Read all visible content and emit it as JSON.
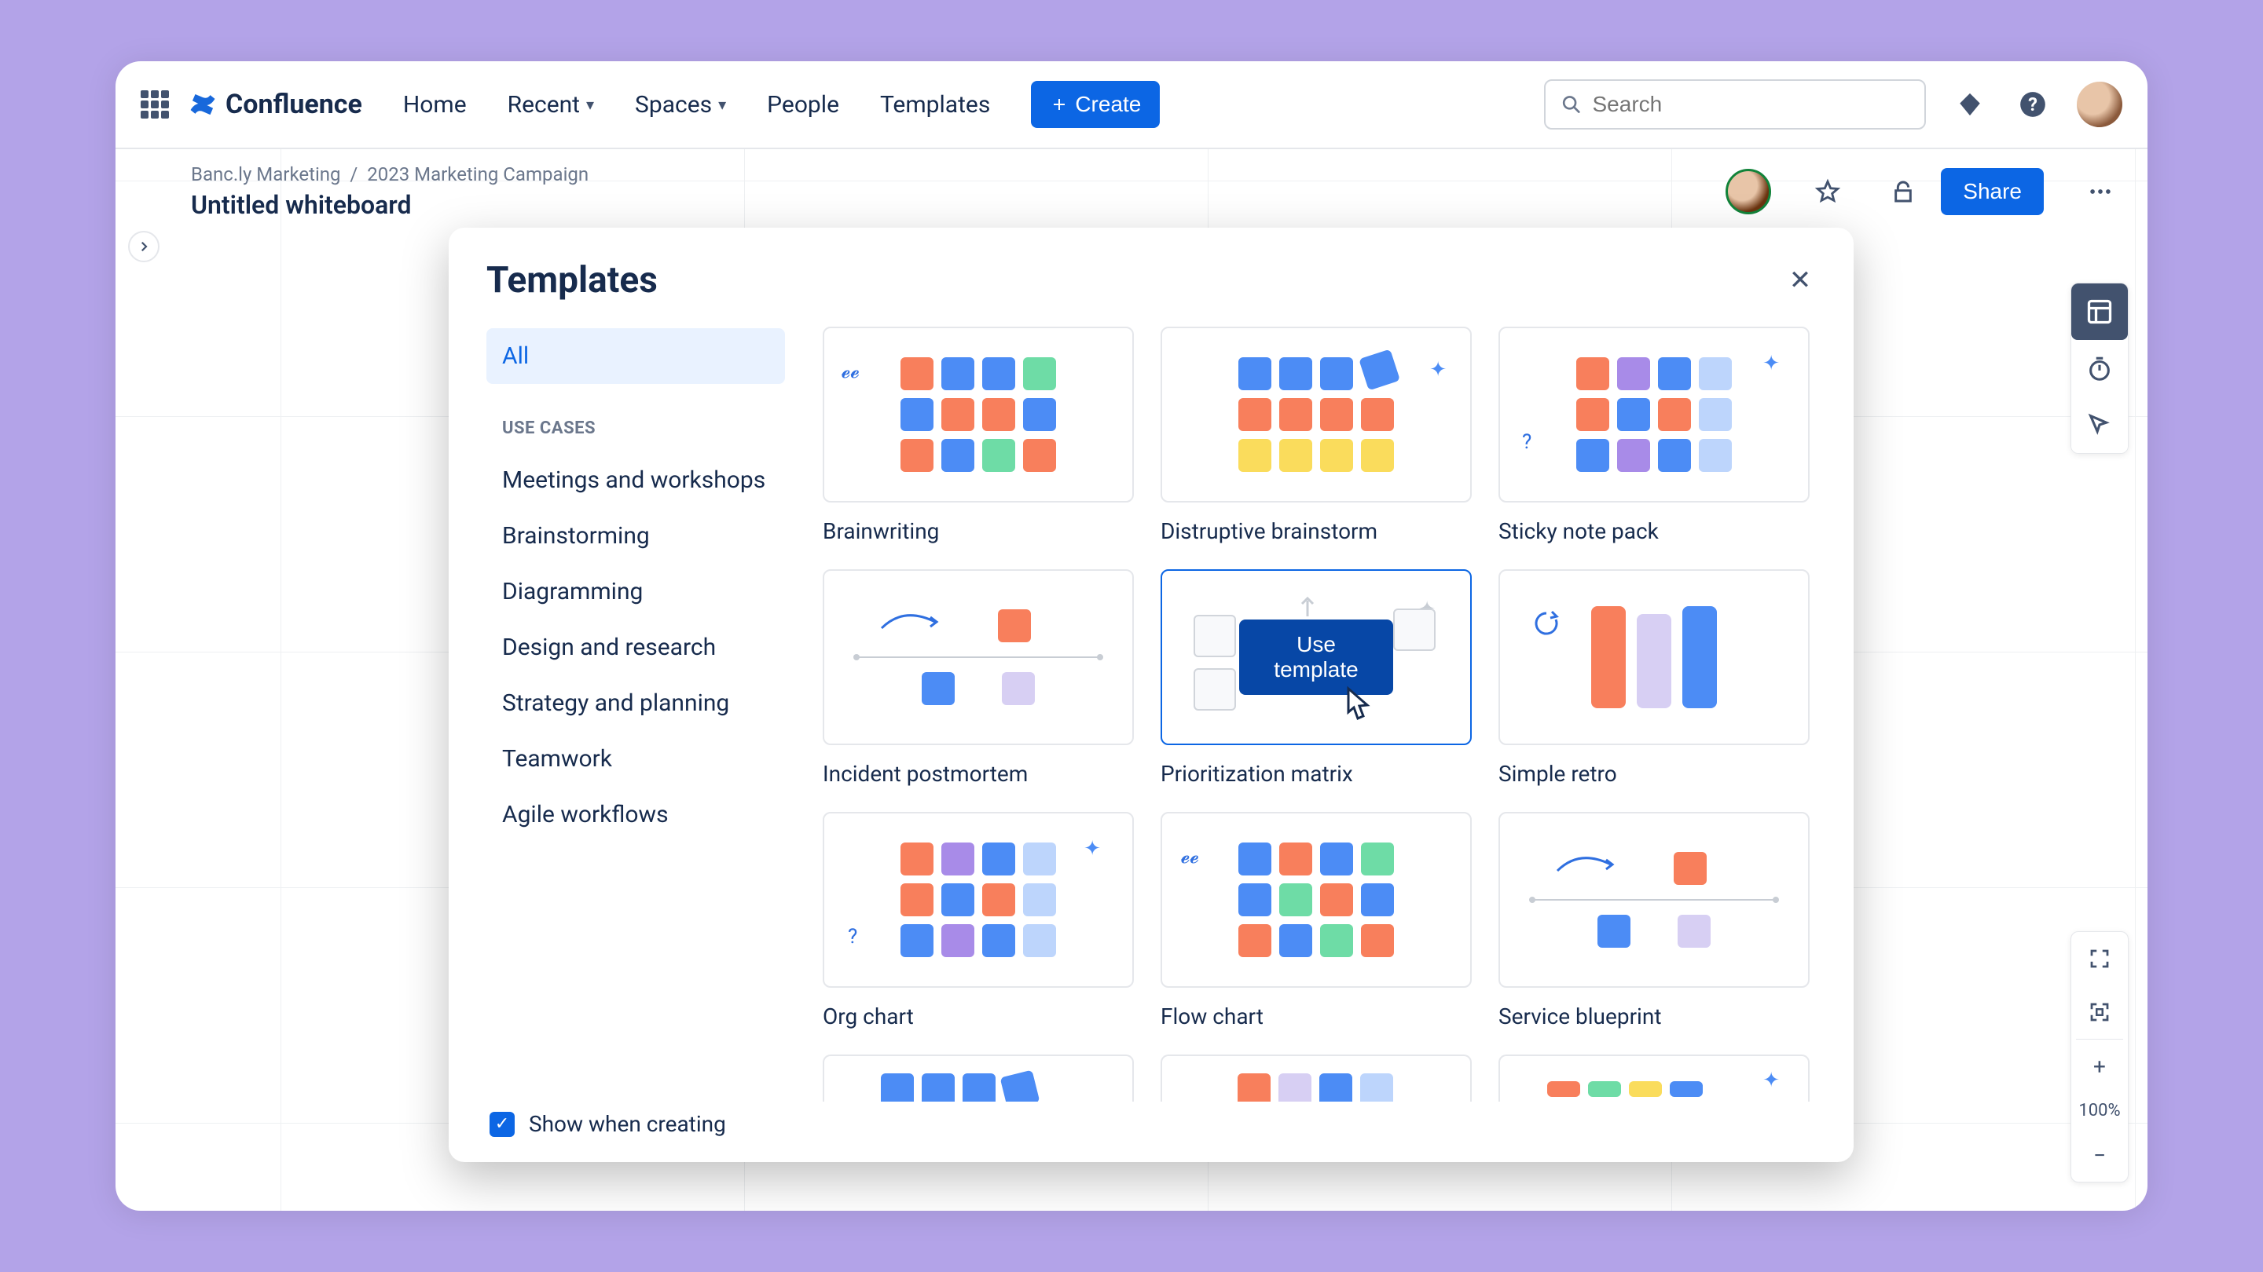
{
  "nav": {
    "product": "Confluence",
    "items": [
      "Home",
      "Recent",
      "Spaces",
      "People",
      "Templates"
    ],
    "create": "Create",
    "search_placeholder": "Search"
  },
  "breadcrumb": {
    "space": "Banc.ly Marketing",
    "page": "2023 Marketing Campaign"
  },
  "page_title": "Untitled whiteboard",
  "share": "Share",
  "zoom_level": "100%",
  "modal": {
    "title": "Templates",
    "sidebar": {
      "all": "All",
      "section": "USE CASES",
      "categories": [
        "Meetings and workshops",
        "Brainstorming",
        "Diagramming",
        "Design and research",
        "Strategy and planning",
        "Teamwork",
        "Agile workflows"
      ],
      "checkbox_label": "Show when creating"
    },
    "use_template": "Use template",
    "templates": [
      "Brainwriting",
      "Distruptive brainstorm",
      "Sticky note pack",
      "Incident postmortem",
      "Prioritization matrix",
      "Simple retro",
      "Org chart",
      "Flow chart",
      "Service blueprint"
    ]
  }
}
